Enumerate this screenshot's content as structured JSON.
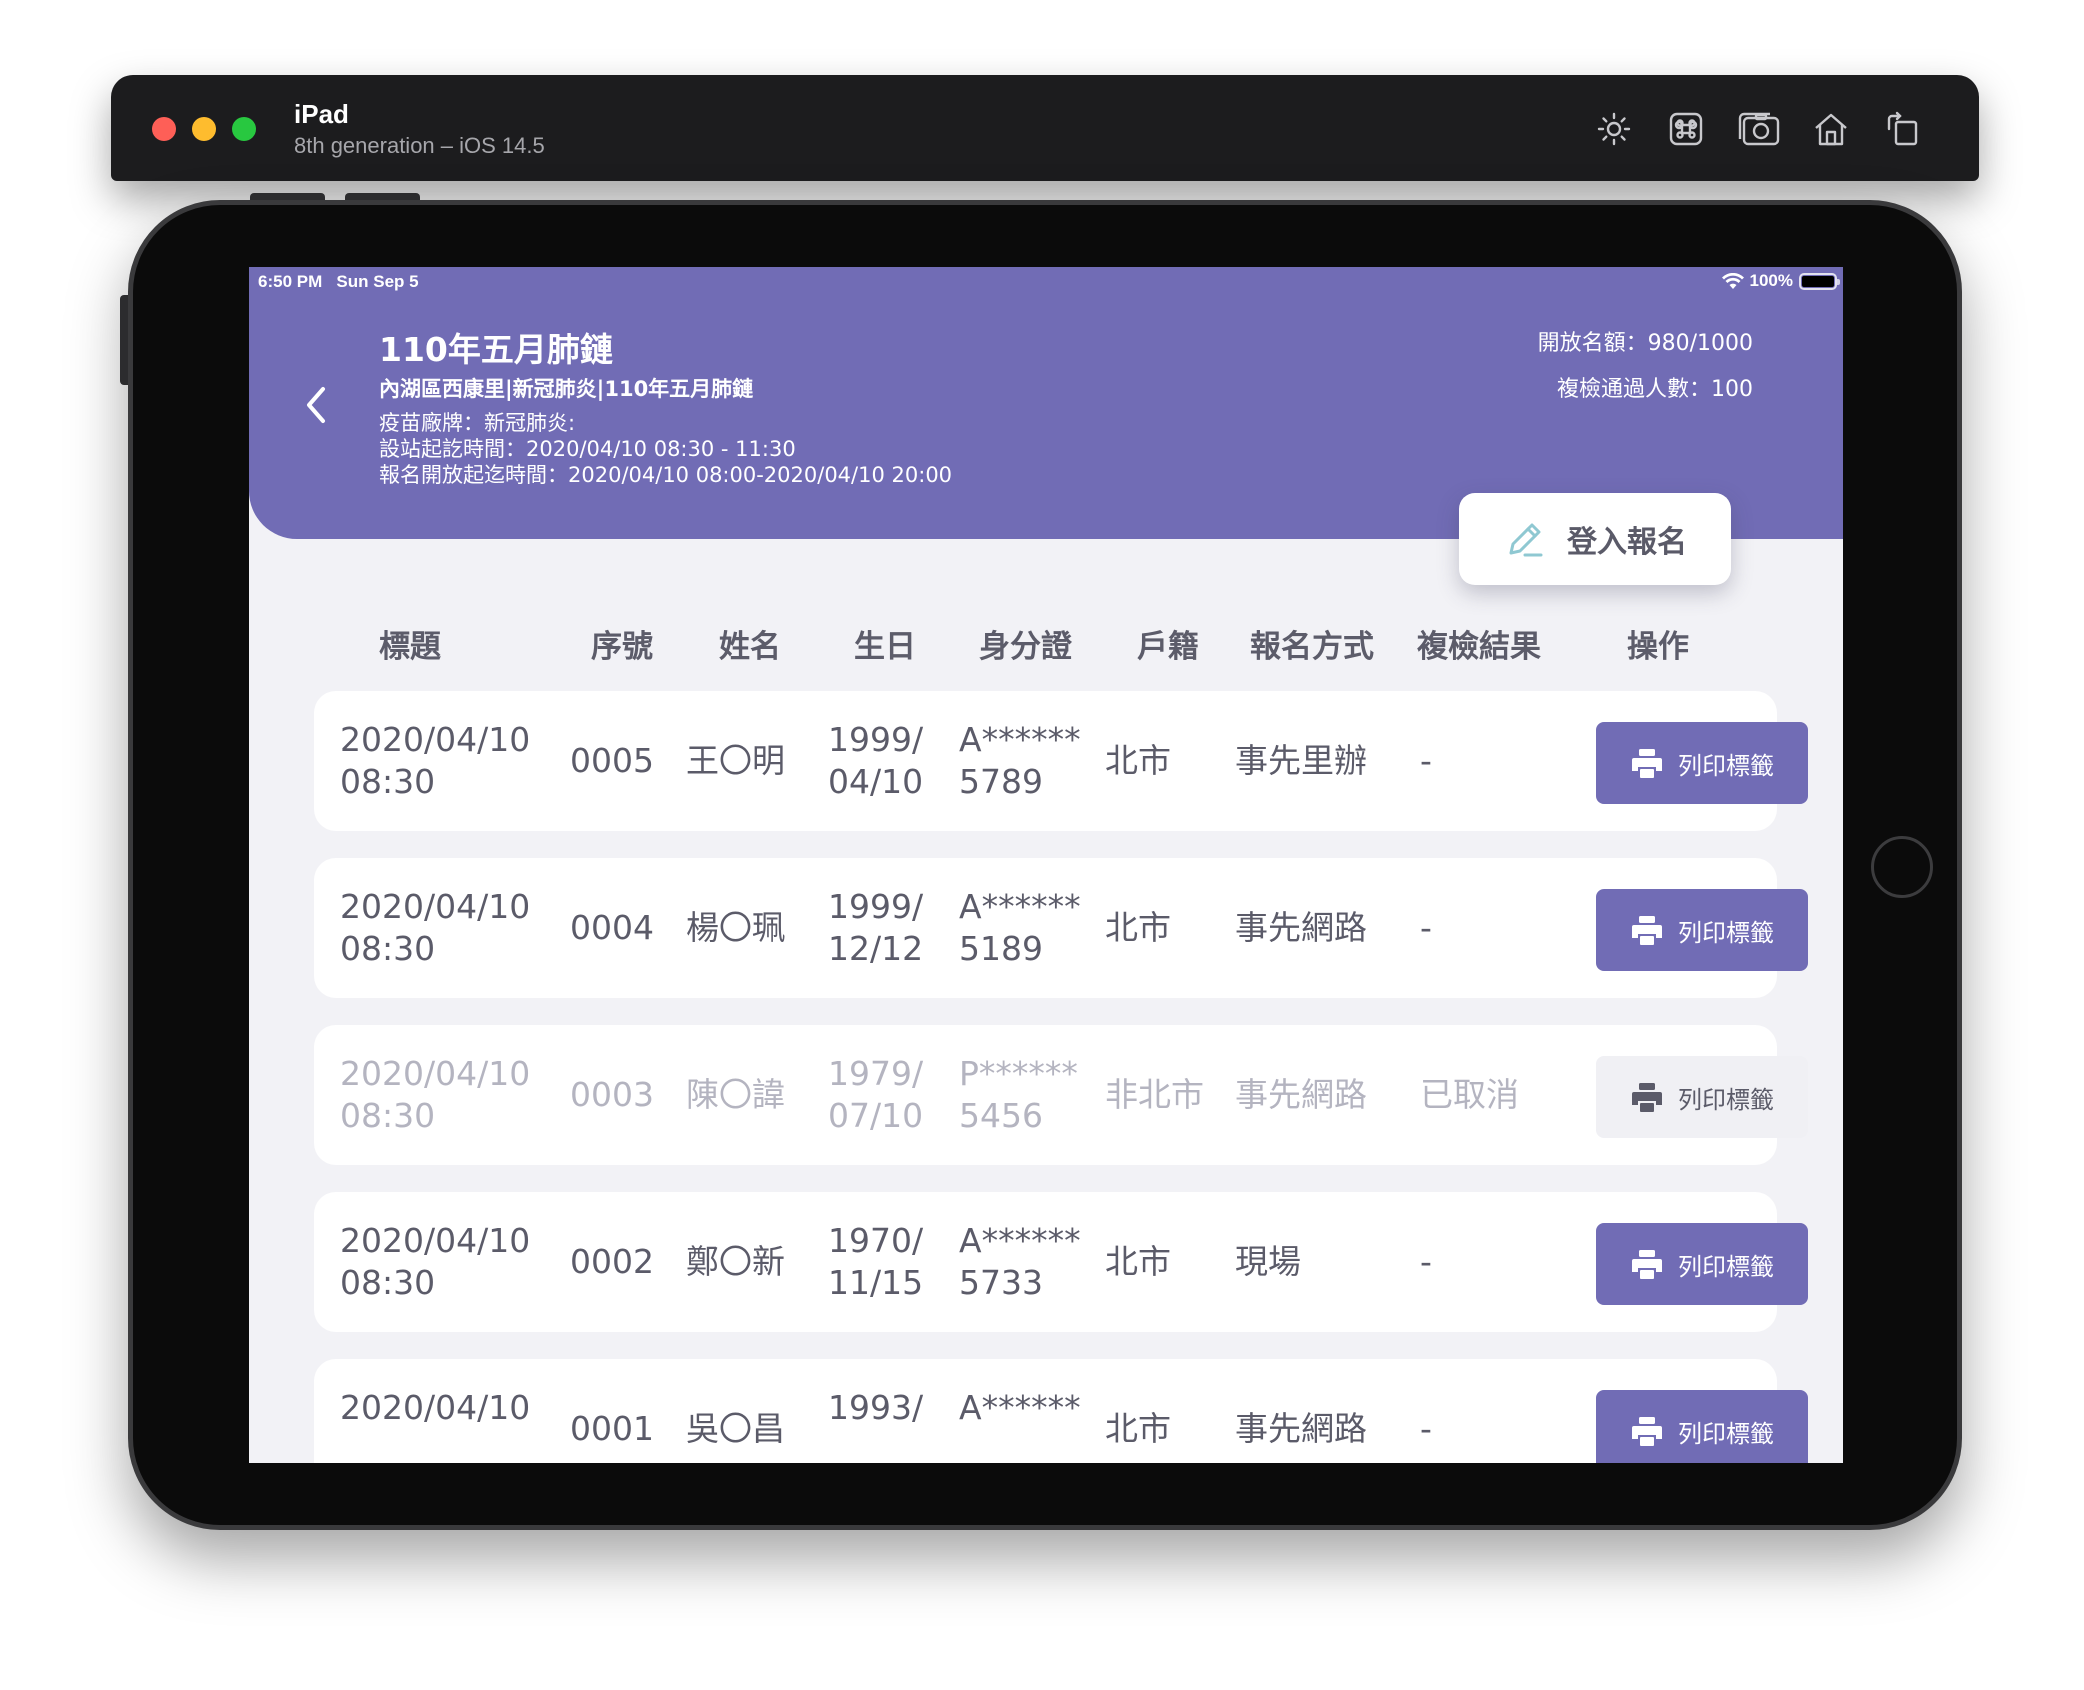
{
  "simulator": {
    "device_name": "iPad",
    "device_info": "8th generation – iOS 14.5",
    "toolbar_icons": [
      "brightness-icon",
      "command-icon",
      "screenshot-icon",
      "home-icon",
      "rotate-icon"
    ]
  },
  "status_bar": {
    "time": "6:50 PM",
    "date": "Sun Sep 5",
    "battery": "100%"
  },
  "event": {
    "title": "110年五月肺鏈",
    "subtitle": "內湖區西康里|新冠肺炎|110年五月肺鏈",
    "vaccine_brand": "疫苗廠牌：新冠肺炎:",
    "station_time": "設站起訖時間：2020/04/10 08:30 - 11:30",
    "registration_time": "報名開放起迄時間：2020/04/10 08:00-2020/04/10 20:00",
    "open_quota": "開放名額：980/1000",
    "passed_count": "複檢通過人數：100"
  },
  "login_button": {
    "label": "登入報名"
  },
  "table": {
    "headers": {
      "title": "標題",
      "serial": "序號",
      "name": "姓名",
      "birthday": "生日",
      "id_card": "身分證",
      "household": "戶籍",
      "method": "報名方式",
      "recheck": "複檢結果",
      "action": "操作"
    },
    "rows": [
      {
        "date": "2020/04/10",
        "time": "08:30",
        "serial": "0005",
        "name": "王〇明",
        "birth_year": "1999/",
        "birth_md": "04/10",
        "id_prefix": "A******",
        "id_suffix": "5789",
        "household": "北市",
        "method": "事先里辦",
        "recheck": "-",
        "action": "列印標籤",
        "cancelled": false
      },
      {
        "date": "2020/04/10",
        "time": "08:30",
        "serial": "0004",
        "name": "楊〇珮",
        "birth_year": "1999/",
        "birth_md": "12/12",
        "id_prefix": "A******",
        "id_suffix": "5189",
        "household": "北市",
        "method": "事先網路",
        "recheck": "-",
        "action": "列印標籤",
        "cancelled": false
      },
      {
        "date": "2020/04/10",
        "time": "08:30",
        "serial": "0003",
        "name": "陳〇諱",
        "birth_year": "1979/",
        "birth_md": "07/10",
        "id_prefix": "P******",
        "id_suffix": "5456",
        "household": "非北市",
        "method": "事先網路",
        "recheck": "已取消",
        "action": "列印標籤",
        "cancelled": true
      },
      {
        "date": "2020/04/10",
        "time": "08:30",
        "serial": "0002",
        "name": "鄭〇新",
        "birth_year": "1970/",
        "birth_md": "11/15",
        "id_prefix": "A******",
        "id_suffix": "5733",
        "household": "北市",
        "method": "現場",
        "recheck": "-",
        "action": "列印標籤",
        "cancelled": false
      },
      {
        "date": "2020/04/10",
        "time": "",
        "serial": "0001",
        "name": "吳〇昌",
        "birth_year": "1993/",
        "birth_md": "",
        "id_prefix": "A******",
        "id_suffix": "",
        "household": "北市",
        "method": "事先網路",
        "recheck": "-",
        "action": "列印標籤",
        "cancelled": false
      }
    ]
  },
  "colors": {
    "primary": "#716cb5",
    "background": "#f2f2f6",
    "text": "#5b5b69",
    "muted_text": "#b4b4c0",
    "card": "#ffffff"
  }
}
